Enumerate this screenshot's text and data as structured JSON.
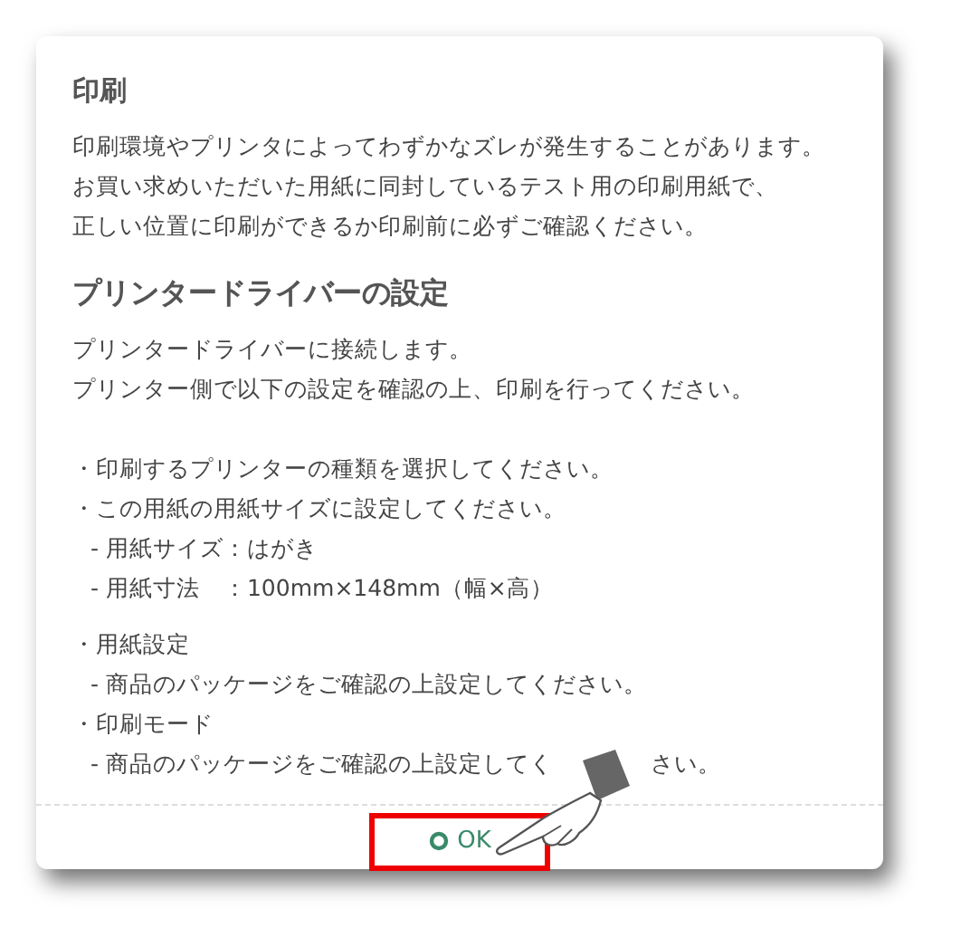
{
  "dialog": {
    "sections": [
      {
        "heading": "印刷",
        "paragraphs": [
          "印刷環境やプリンタによってわずかなズレが発生することがあります。",
          "お買い求めいただいた用紙に同封しているテスト用の印刷用紙で、",
          "正しい位置に印刷ができるか印刷前に必ずご確認ください。"
        ]
      },
      {
        "heading": "プリンタードライバーの設定",
        "paragraphs": [
          "プリンタードライバーに接続します。",
          "プリンター側で以下の設定を確認の上、印刷を行ってください。"
        ],
        "list_groups": [
          {
            "items": [
              {
                "kind": "bullet",
                "text": "・印刷するプリンターの種類を選択してください。"
              },
              {
                "kind": "bullet",
                "text": "・この用紙の用紙サイズに設定してください。"
              },
              {
                "kind": "sub",
                "text": "- 用紙サイズ：はがき"
              },
              {
                "kind": "sub",
                "text": "- 用紙寸法　：100mm×148mm（幅×高）"
              }
            ]
          },
          {
            "items": [
              {
                "kind": "bullet",
                "text": "・用紙設定"
              },
              {
                "kind": "sub",
                "text": "- 商品のパッケージをご確認の上設定してください。"
              },
              {
                "kind": "bullet",
                "text": "・印刷モード"
              },
              {
                "kind": "sub",
                "text": "- 商品のパッケージをご確認の上設定してく",
                "tail": "さい。"
              }
            ]
          }
        ]
      }
    ],
    "button": {
      "label": "OK"
    }
  }
}
